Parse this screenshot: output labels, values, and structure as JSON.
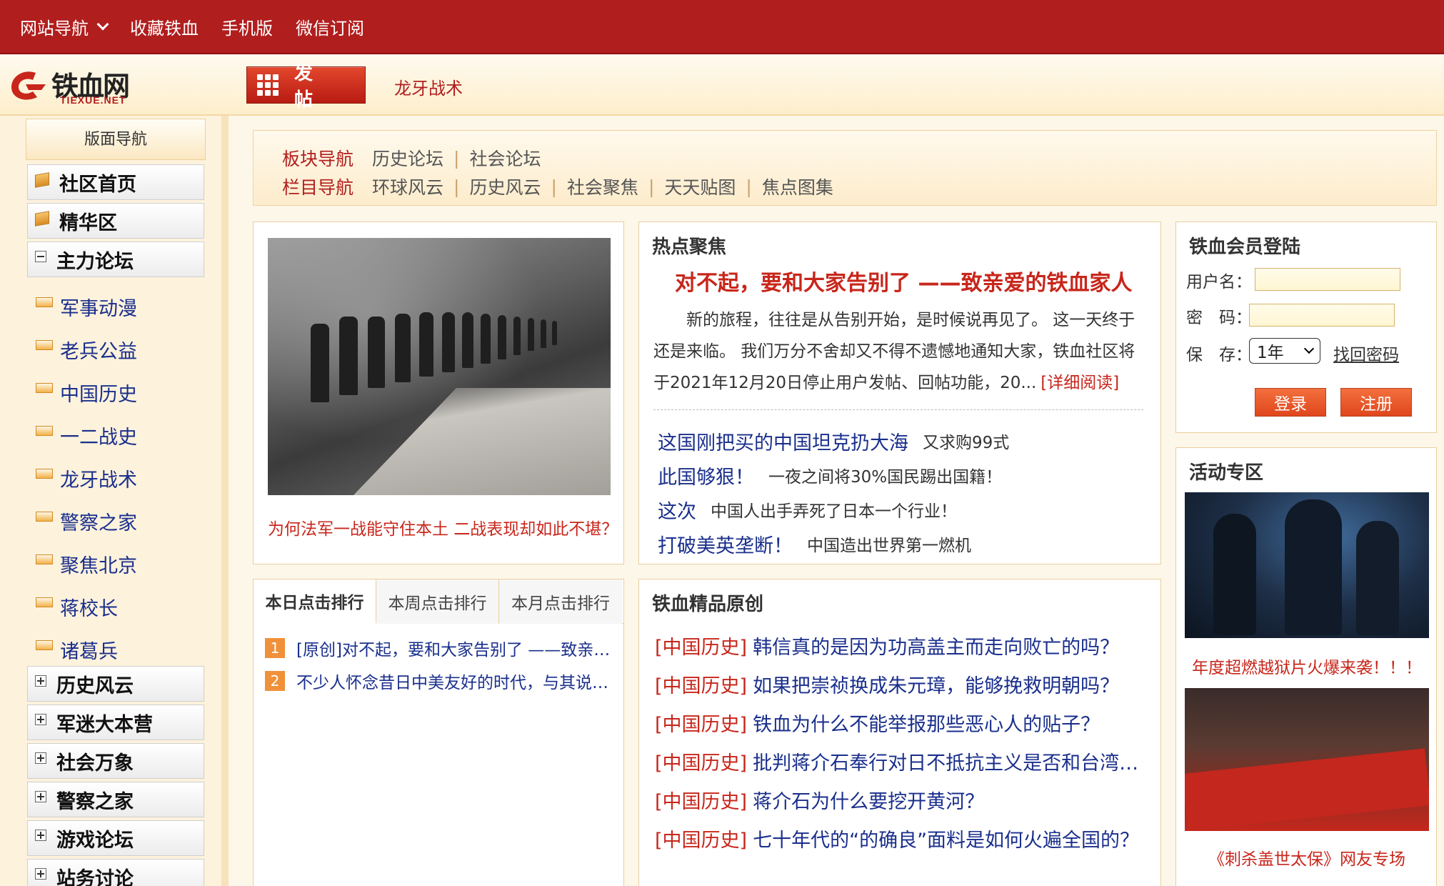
{
  "topbar": {
    "items": [
      "网站导航",
      "收藏铁血",
      "手机版",
      "微信订阅"
    ]
  },
  "header": {
    "logo_cn": "铁血网",
    "logo_en": "TIEXUE.NET",
    "post_button": "发帖",
    "link": "龙牙战术"
  },
  "sidebar": {
    "title": "版面导航",
    "top_items": [
      "社区首页",
      "精华区"
    ],
    "main_forum": "主力论坛",
    "sub_items": [
      "军事动漫",
      "老兵公益",
      "中国历史",
      "一二战史",
      "龙牙战术",
      "警察之家",
      "聚焦北京",
      "蒋校长",
      "诸葛兵"
    ],
    "groups": [
      "历史风云",
      "军迷大本营",
      "社会万象",
      "警察之家",
      "游戏论坛",
      "站务讨论"
    ]
  },
  "board_nav": {
    "row1_head": "板块导航",
    "row1_links": [
      "历史论坛",
      "社会论坛"
    ],
    "row2_head": "栏目导航",
    "row2_links": [
      "环球风云",
      "历史风云",
      "社会聚焦",
      "天天贴图",
      "焦点图集"
    ]
  },
  "photo": {
    "caption": "为何法军一战能守住本土 二战表现却如此不堪？"
  },
  "hot": {
    "title": "热点聚焦",
    "headline": "对不起，要和大家告别了 ——致亲爱的铁血家人",
    "summary": "新的旅程，往往是从告别开始，是时候说再见了。 这一天终于还是来临。 我们万分不舍却又不得不遗憾地通知大家，铁血社区将于2021年12月20日停止用户发帖、回帖功能，20...",
    "more": "[详细阅读]",
    "items": [
      {
        "title": "这国刚把买的中国坦克扔大海",
        "sub": "又求购99式"
      },
      {
        "title": "此国够狠！",
        "sub": "一夜之间将30%国民踢出国籍！"
      },
      {
        "title": "这次",
        "sub": "中国人出手弄死了日本一个行业！"
      },
      {
        "title": "打破美英垄断！",
        "sub": "中国造出世界第一燃机"
      }
    ]
  },
  "login": {
    "title": "铁血会员登陆",
    "username_label": "用户名：",
    "password_label": "密　码：",
    "remember_label": "保　存：",
    "remember_value": "1年",
    "forgot": "找回密码",
    "login_button": "登录",
    "register_button": "注册"
  },
  "activity": {
    "title": "活动专区",
    "caption1": "年度超燃越狱片火爆来袭！！！",
    "caption2": "《刺杀盖世太保》网友专场"
  },
  "rank": {
    "tabs": [
      "本日点击排行",
      "本周点击排行",
      "本月点击排行"
    ],
    "items": [
      {
        "num": "1",
        "text": "[原创]对不起，要和大家告别了 ——致亲爱的铁血家人"
      },
      {
        "num": "2",
        "text": "不少人怀念昔日中美友好的时代，与其说是怀念"
      }
    ]
  },
  "original": {
    "title": "铁血精品原创",
    "items": [
      {
        "tag": "[中国历史]",
        "text": "韩信真的是因为功高盖主而走向败亡的吗？"
      },
      {
        "tag": "[中国历史]",
        "text": "如果把崇祯换成朱元璋，能够挽救明朝吗？"
      },
      {
        "tag": "[中国历史]",
        "text": "铁血为什么不能举报那些恶心人的贴子？"
      },
      {
        "tag": "[中国历史]",
        "text": "批判蒋介石奉行对日不抵抗主义是否和台湾民进党"
      },
      {
        "tag": "[中国历史]",
        "text": "蒋介石为什么要挖开黄河？"
      },
      {
        "tag": "[中国历史]",
        "text": "七十年代的“的确良”面料是如何火遍全国的？"
      }
    ]
  }
}
